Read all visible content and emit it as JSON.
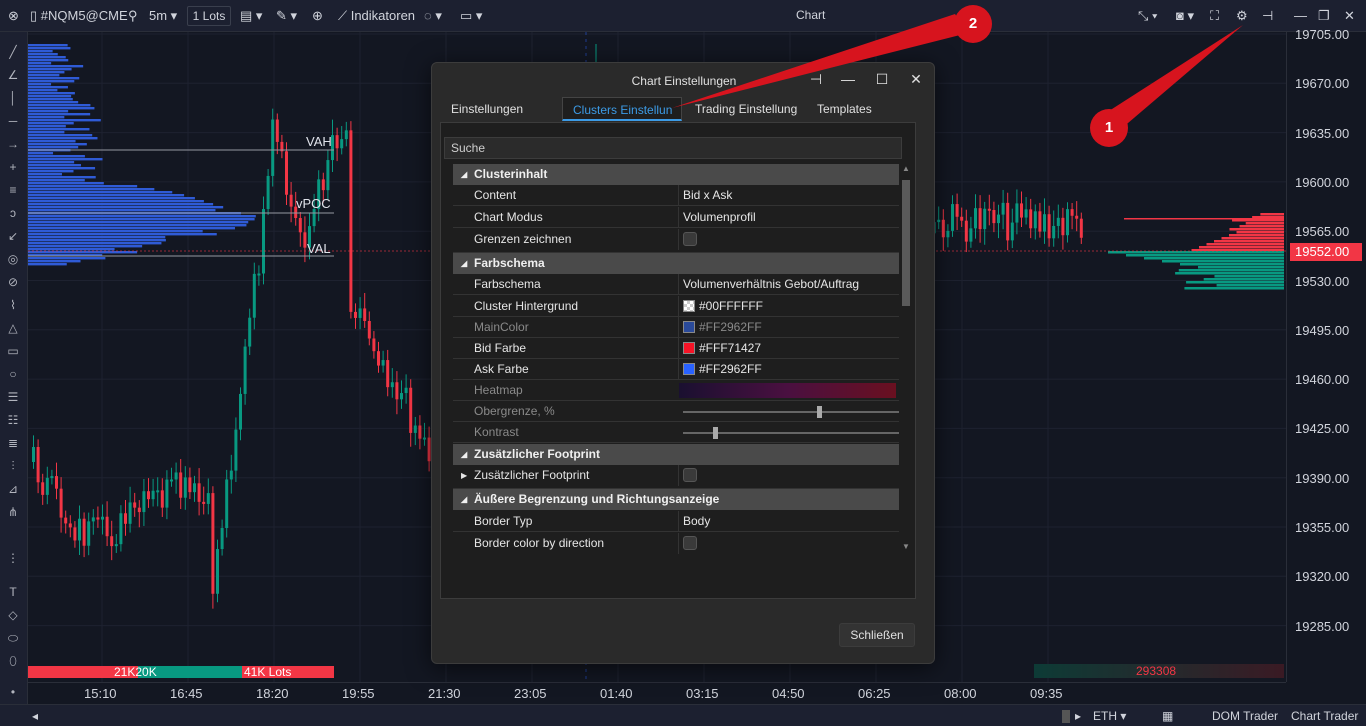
{
  "topbar": {
    "symbol": "#NQM5@CME",
    "timeframe": "5m",
    "lots": "1 Lots",
    "indicators": "Indikatoren",
    "window_title": "Chart"
  },
  "chart": {
    "last_price": "19552.00",
    "y_labels": [
      "19705.00",
      "19670.00",
      "19635.00",
      "19600.00",
      "19565.00",
      "19530.00",
      "19495.00",
      "19460.00",
      "19425.00",
      "19390.00",
      "19355.00",
      "19320.00",
      "19285.00"
    ],
    "x_labels": [
      "15:10",
      "16:45",
      "18:20",
      "19:55",
      "21:30",
      "23:05",
      "01:40",
      "03:15",
      "04:50",
      "06:25",
      "08:00",
      "09:35"
    ],
    "profile_labels": {
      "vah": "VAH",
      "vpoc": "vPOC",
      "val": "VAL"
    },
    "volume_texts": {
      "left1": "21K20K",
      "left2": "41K Lots",
      "right": "293308"
    }
  },
  "dialog": {
    "title": "Chart Einstellungen",
    "tabs": [
      "Einstellungen",
      "Clusters Einstellun",
      "Trading Einstellung",
      "Templates"
    ],
    "search_placeholder": "Suche",
    "sections": {
      "s1": "Clusterinhalt",
      "s2": "Farbschema",
      "s3": "Zusätzlicher Footprint",
      "s4": "Äußere Begrenzung und Richtungsanzeige"
    },
    "rows": {
      "content": {
        "k": "Content",
        "v": "Bid x Ask"
      },
      "mode": {
        "k": "Chart Modus",
        "v": "Volumenprofil"
      },
      "borders": {
        "k": "Grenzen zeichnen"
      },
      "scheme": {
        "k": "Farbschema",
        "v": "Volumenverhältnis Gebot/Auftrag"
      },
      "bg": {
        "k": "Cluster Hintergrund",
        "v": "#00FFFFFF"
      },
      "main": {
        "k": "MainColor",
        "v": "#FF2962FF"
      },
      "bid": {
        "k": "Bid Farbe",
        "v": "#FFF71427"
      },
      "ask": {
        "k": "Ask Farbe",
        "v": "#FF2962FF"
      },
      "heatmap": {
        "k": "Heatmap"
      },
      "upper": {
        "k": "Obergrenze, %"
      },
      "contrast": {
        "k": "Kontrast"
      },
      "extra": {
        "k": "Zusätzlicher Footprint"
      },
      "btype": {
        "k": "Border Typ",
        "v": "Body"
      },
      "bdir": {
        "k": "Border color by direction"
      }
    },
    "close": "Schließen",
    "colors": {
      "bid": "#f71427",
      "ask": "#2962ff",
      "main": "#2962ff"
    }
  },
  "annotations": {
    "badge1": "1",
    "badge2": "2"
  },
  "bottombar": {
    "session": "ETH",
    "dom": "DOM Trader",
    "chart_trader": "Chart Trader"
  }
}
